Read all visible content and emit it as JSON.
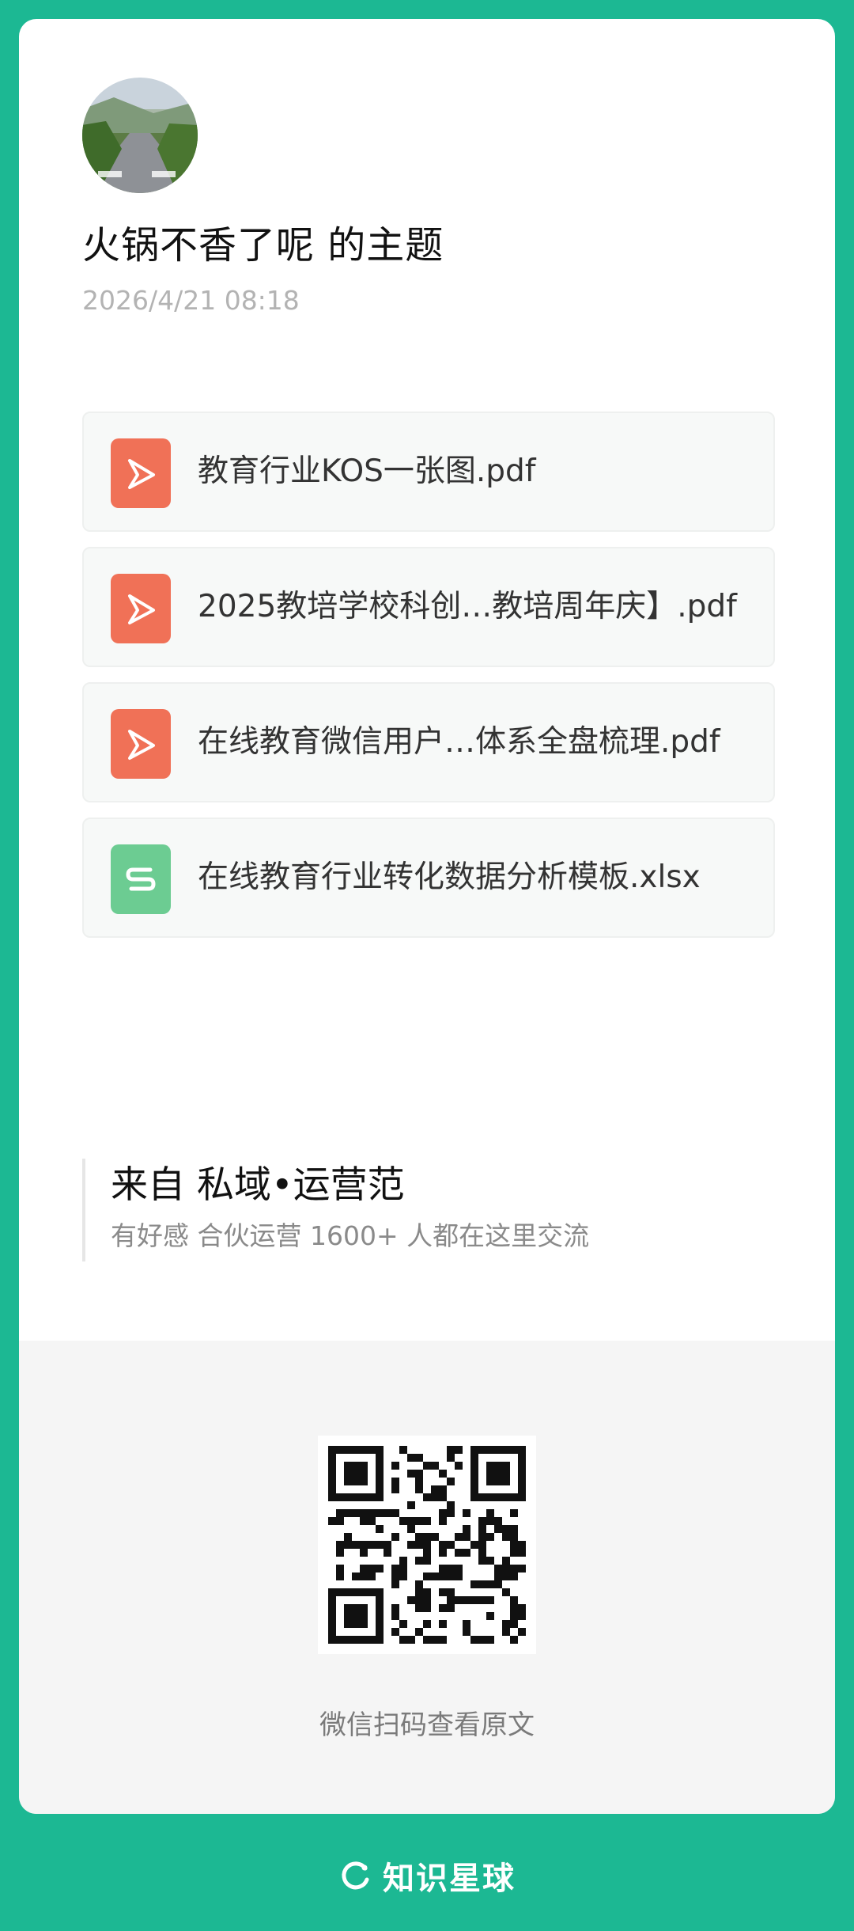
{
  "post": {
    "title": "火锅不香了呢 的主题",
    "datetime": "2026/4/21 08:18",
    "avatar_icon": "avatar-road-photo"
  },
  "files": [
    {
      "name": "教育行业KOS一张图.pdf",
      "type": "pdf",
      "icon": "pdf-icon"
    },
    {
      "name": "2025教培学校科创…教培周年庆】.pdf",
      "type": "pdf",
      "icon": "pdf-icon"
    },
    {
      "name": "在线教育微信用户…体系全盘梳理.pdf",
      "type": "pdf",
      "icon": "pdf-icon"
    },
    {
      "name": "在线教育行业转化数据分析模板.xlsx",
      "type": "xlsx",
      "icon": "spreadsheet-icon"
    }
  ],
  "source": {
    "title": "来自 私域•运营范",
    "description": "有好感 合伙运营 1600+ 人都在这里交流"
  },
  "qr": {
    "caption": "微信扫码查看原文"
  },
  "footer": {
    "brand": "知识星球"
  },
  "colors": {
    "background": "#1cb893",
    "pdf_icon": "#f07157",
    "xlsx_icon": "#6ccc92"
  }
}
